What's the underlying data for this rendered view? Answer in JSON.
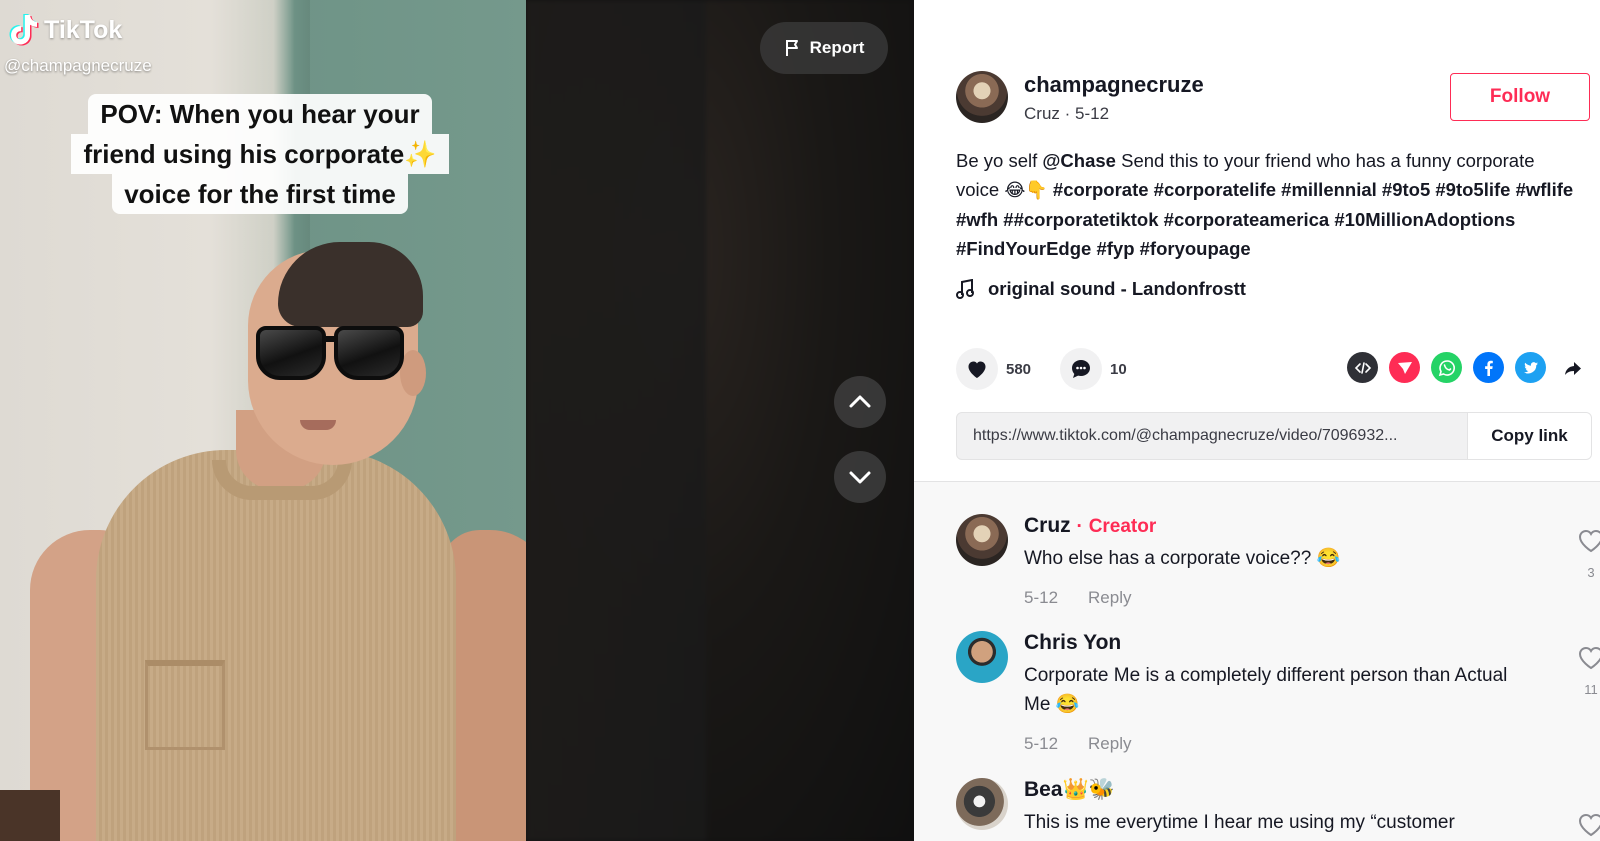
{
  "video": {
    "brand": "TikTok",
    "watermark_user": "@champagnecruze",
    "caption_lines": [
      "POV: When you hear your",
      "friend using his corporate✨",
      "voice for the first time"
    ],
    "report_label": "Report"
  },
  "author": {
    "username": "champagnecruze",
    "meta": "Cruz · 5-12",
    "follow_label": "Follow"
  },
  "description": {
    "prefix": "Be yo self ",
    "mention": "@Chase",
    "text": " Send this to your friend who has a funny corporate voice ",
    "emojis": "😂👇",
    "hashtags": "#corporate #corporatelife #millennial #9to5 #9to5life #wflife #wfh ##corporatetiktok #corporateamerica #10MillionAdoptions #FindYourEdge #fyp #foryoupage"
  },
  "music": {
    "label": "original sound - Landonfrostt"
  },
  "actions": {
    "likes": "580",
    "comments": "10"
  },
  "share_icons": [
    "embed-icon",
    "send-to-friends-icon",
    "whatsapp-icon",
    "facebook-icon",
    "twitter-icon",
    "share-arrow-icon"
  ],
  "link": {
    "url": "https://www.tiktok.com/@champagnecruze/video/7096932...",
    "copy_label": "Copy link"
  },
  "comments": [
    {
      "name": "Cruz",
      "creator_label": "Creator",
      "text": "Who else has a corporate voice?? 😂",
      "date": "5-12",
      "reply": "Reply",
      "likes": "3"
    },
    {
      "name": "Chris Yon",
      "text": "Corporate Me is a completely different person than Actual Me 😂",
      "date": "5-12",
      "reply": "Reply",
      "likes": "11"
    },
    {
      "name": "Bea👑🐝",
      "text": "This is me everytime I hear me using my “customer",
      "likes": ""
    }
  ],
  "colors": {
    "accent": "#fe2c55",
    "text": "#161823",
    "muted": "#8a8b91"
  }
}
